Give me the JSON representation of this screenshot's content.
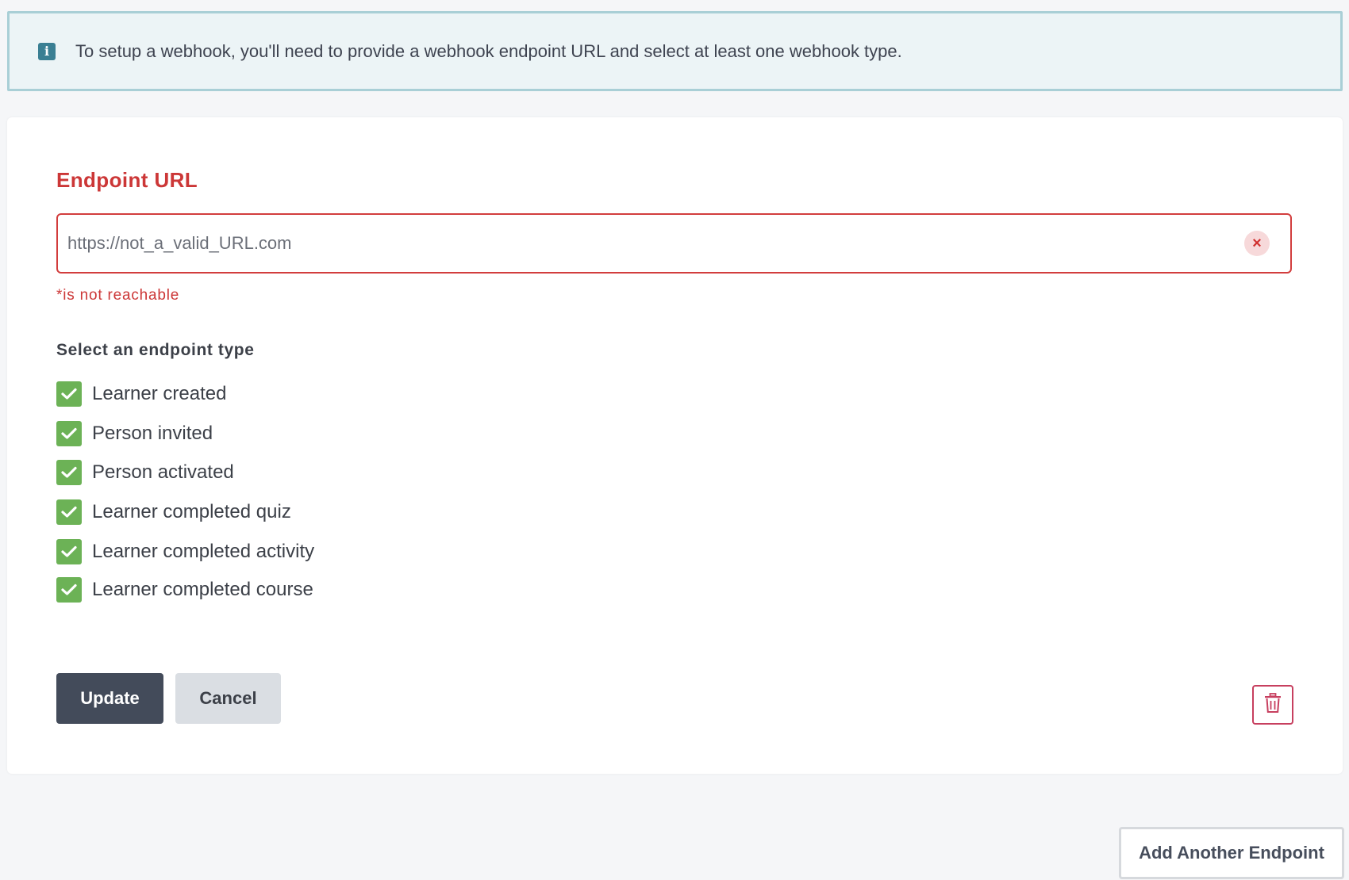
{
  "banner": {
    "icon": "info-icon",
    "icon_glyph": "i",
    "text": "To setup a webhook, you'll need to provide a webhook endpoint URL and select at least one webhook type."
  },
  "endpoint": {
    "label": "Endpoint URL",
    "url_value": "https://not_a_valid_URL.com",
    "clear_glyph": "×",
    "error": "*is not reachable"
  },
  "types": {
    "label": "Select an endpoint type",
    "options": [
      {
        "label": "Learner created",
        "checked": true
      },
      {
        "label": "Person invited",
        "checked": true
      },
      {
        "label": "Person activated",
        "checked": true
      },
      {
        "label": "Learner completed quiz",
        "checked": true
      },
      {
        "label": "Learner completed activity",
        "checked": true
      },
      {
        "label": "Learner completed course",
        "checked": true
      }
    ]
  },
  "actions": {
    "update_label": "Update",
    "cancel_label": "Cancel",
    "delete_icon": "trash-icon"
  },
  "footer": {
    "add_label": "Add Another Endpoint"
  },
  "colors": {
    "error": "#cc3737",
    "checkbox": "#6cb256",
    "primary_button": "#434b5a",
    "info": "#3a7f93"
  }
}
